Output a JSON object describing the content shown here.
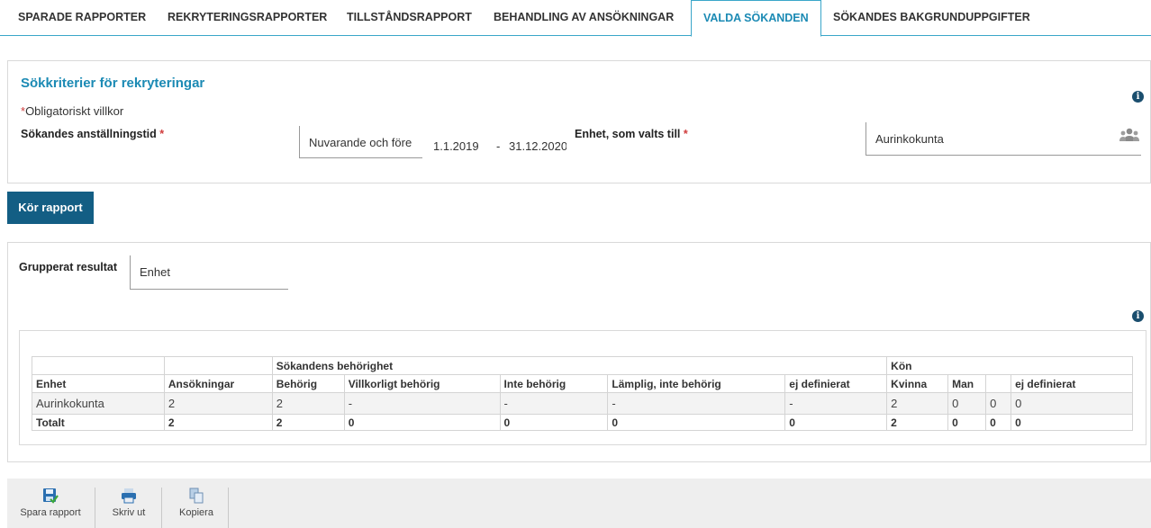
{
  "tabs": [
    {
      "label": "SPARADE RAPPORTER"
    },
    {
      "label": "REKRYTERINGSRAPPORTER"
    },
    {
      "label": "TILLSTÅNDSRAPPORT"
    },
    {
      "label": "BEHANDLING AV ANSÖKNINGAR"
    },
    {
      "label": "VALDA SÖKANDEN",
      "active": true
    },
    {
      "label": "SÖKANDES BAKGRUNDUPPGIFTER"
    }
  ],
  "criteria": {
    "title": "Sökkriterier för rekryteringar",
    "required_marker": "*",
    "required_note": "Obligatoriskt villkor",
    "employment_label": "Sökandes anställningstid",
    "employment_value": "Nuvarande och före",
    "date_from": "1.1.2019",
    "date_sep": "-",
    "date_to": "31.12.2020",
    "unit_label": "Enhet, som valts till",
    "unit_value": "Aurinkokunta"
  },
  "run_button": "Kör rapport",
  "grouping": {
    "label": "Grupperat resultat",
    "value": "Enhet"
  },
  "table": {
    "group_headers": [
      "Sökandens behörighet",
      "Kön"
    ],
    "columns": [
      "Enhet",
      "Ansökningar",
      "Behörig",
      "Villkorligt behörig",
      "Inte behörig",
      "Lämplig, inte behörig",
      "ej definierat",
      "Kvinna",
      "Man",
      "",
      "ej definierat"
    ],
    "rows": [
      [
        "Aurinkokunta",
        "2",
        "2",
        "-",
        "-",
        "-",
        "-",
        "2",
        "0",
        "0",
        "0"
      ]
    ],
    "totals": [
      "Totalt",
      "2",
      "2",
      "0",
      "0",
      "0",
      "0",
      "2",
      "0",
      "0",
      "0"
    ]
  },
  "toolbar": {
    "save": "Spara rapport",
    "print": "Skriv ut",
    "copy": "Kopiera"
  },
  "colors": {
    "accent": "#1b8ab4",
    "button": "#135e84",
    "required": "#d03c3c"
  },
  "icons": {
    "info": "info-icon",
    "unit_picker": "people-icon",
    "save": "save-icon",
    "print": "printer-icon",
    "copy": "copy-icon"
  }
}
